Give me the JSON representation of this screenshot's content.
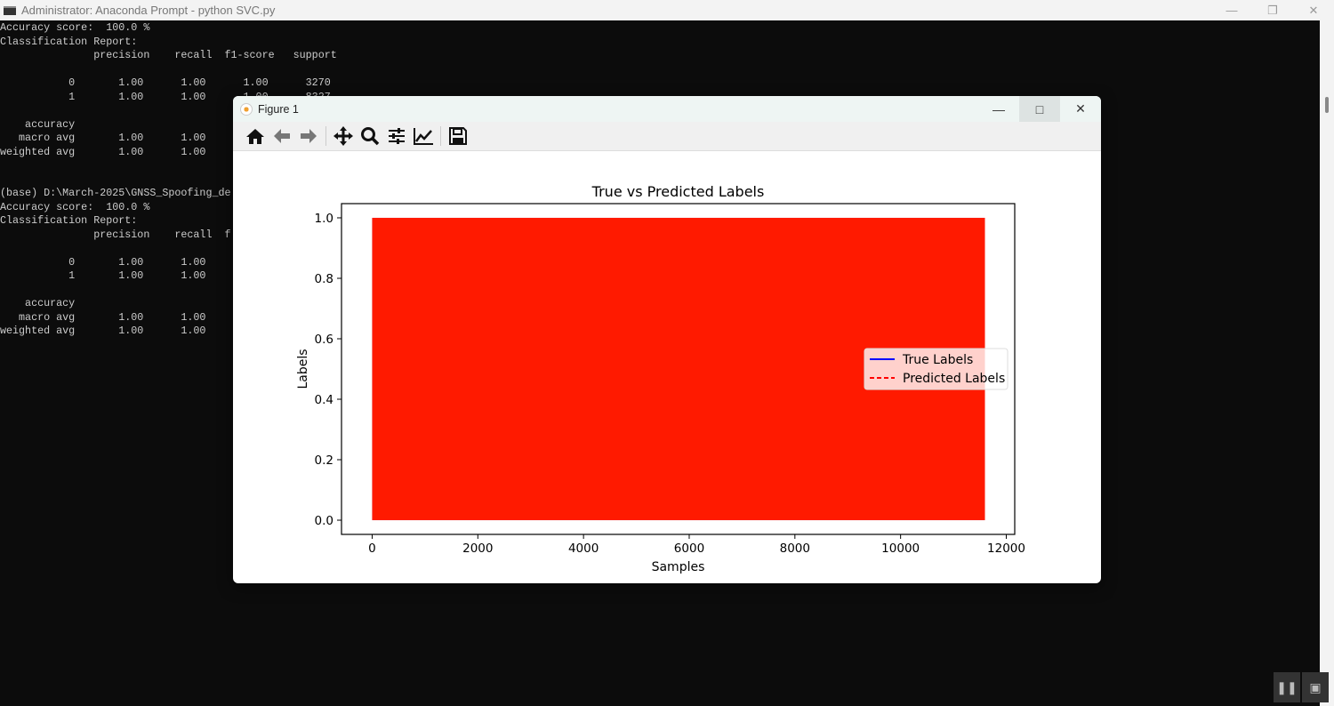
{
  "console": {
    "title": "Administrator: Anaconda Prompt - python  SVC.py",
    "lines": [
      "Accuracy score:  100.0 %",
      "Classification Report:",
      "               precision    recall  f1-score   support",
      "",
      "           0       1.00      1.00      1.00      3270",
      "           1       1.00      1.00      1.00      8327",
      "",
      "    accuracy",
      "   macro avg       1.00      1.00",
      "weighted avg       1.00      1.00",
      "",
      "",
      "(base) D:\\March-2025\\GNSS_Spoofing_de",
      "Accuracy score:  100.0 %",
      "Classification Report:",
      "               precision    recall  f",
      "",
      "           0       1.00      1.00",
      "           1       1.00      1.00",
      "",
      "    accuracy",
      "   macro avg       1.00      1.00",
      "weighted avg       1.00      1.00"
    ]
  },
  "figure": {
    "title": "Figure 1",
    "toolbar": [
      "home",
      "back",
      "forward",
      "pan",
      "zoom",
      "configure-subplots",
      "edit-axis",
      "save"
    ]
  },
  "chart_data": {
    "type": "line",
    "title": "True vs Predicted Labels",
    "xlabel": "Samples",
    "ylabel": "Labels",
    "xlim": [
      -580,
      12160
    ],
    "ylim": [
      -0.047,
      1.047
    ],
    "xticks": [
      0,
      2000,
      4000,
      6000,
      8000,
      10000,
      12000
    ],
    "xtick_labels": [
      "0",
      "2000",
      "4000",
      "6000",
      "8000",
      "10000",
      "12000"
    ],
    "yticks": [
      0.0,
      0.2,
      0.4,
      0.6,
      0.8,
      1.0
    ],
    "ytick_labels": [
      "0.0",
      "0.2",
      "0.4",
      "0.6",
      "0.8",
      "1.0"
    ],
    "n_samples": 11597,
    "series": [
      {
        "name": "True Labels",
        "color": "#0000ff",
        "style": "solid",
        "values_range": [
          0,
          1
        ]
      },
      {
        "name": "Predicted Labels",
        "color": "#ff0000",
        "style": "dashed",
        "values_range": [
          0,
          1
        ]
      }
    ],
    "legend": "center-right",
    "grid": false
  }
}
